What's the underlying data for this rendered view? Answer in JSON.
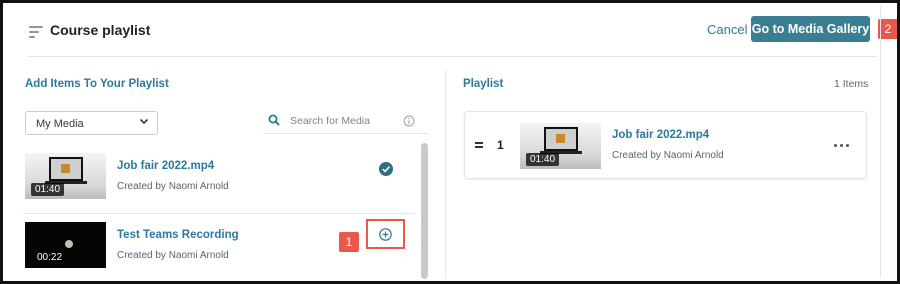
{
  "header": {
    "title": "Course playlist",
    "icon": "playlist-icon",
    "cancel_label": "Cancel",
    "gallery_label": "Go to Media Gallery",
    "badge": "2"
  },
  "left": {
    "section_title": "Add Items To Your Playlist",
    "filter": {
      "selected": "My Media"
    },
    "search": {
      "placeholder": "Search for Media"
    },
    "items": [
      {
        "title": "Job fair 2022.mp4",
        "creator": "Created by Naomi Arnold",
        "duration": "01:40",
        "state": "added"
      },
      {
        "title": "Test Teams Recording",
        "creator": "Created by Naomi Arnold",
        "duration": "00:22",
        "state": "add"
      }
    ],
    "badge": "1"
  },
  "right": {
    "section_title": "Playlist",
    "count": "1 Items",
    "items": [
      {
        "order": "1",
        "title": "Job fair 2022.mp4",
        "creator": "Created by Naomi Arnold",
        "duration": "01:40"
      }
    ]
  },
  "colors": {
    "accent": "#2b7a9e",
    "button": "#3a7e94",
    "annotation": "#e8584b"
  }
}
